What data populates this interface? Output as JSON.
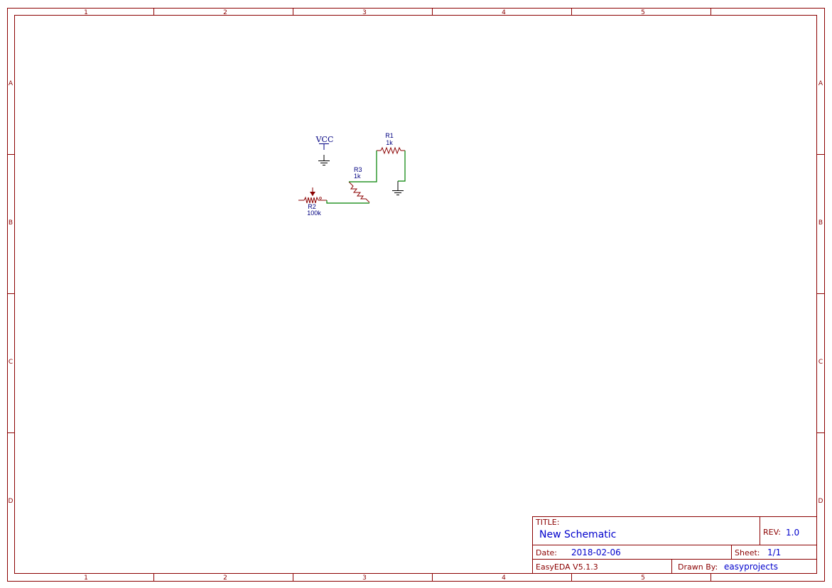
{
  "sheet": {
    "column_labels": [
      "1",
      "2",
      "3",
      "4",
      "5"
    ],
    "row_labels": [
      "A",
      "B",
      "C",
      "D"
    ]
  },
  "title_block": {
    "title_label": "TITLE:",
    "title": "New Schematic",
    "rev_label": "REV:",
    "rev": "1.0",
    "date_label": "Date:",
    "date": "2018-02-06",
    "sheet_label": "Sheet:",
    "sheet": "1/1",
    "software": "EasyEDA V5.1.3",
    "drawn_by_label": "Drawn By:",
    "drawn_by": "easyprojects"
  },
  "components": {
    "vcc": {
      "net": "VCC"
    },
    "r1": {
      "designator": "R1",
      "value": "1k"
    },
    "r2": {
      "designator": "R2",
      "value": "100k"
    },
    "r3": {
      "designator": "R3",
      "value": "1k"
    }
  },
  "colors": {
    "frame": "#8b0000",
    "wire": "#008000",
    "text_blue": "#000080",
    "value_blue": "#0000cc"
  }
}
